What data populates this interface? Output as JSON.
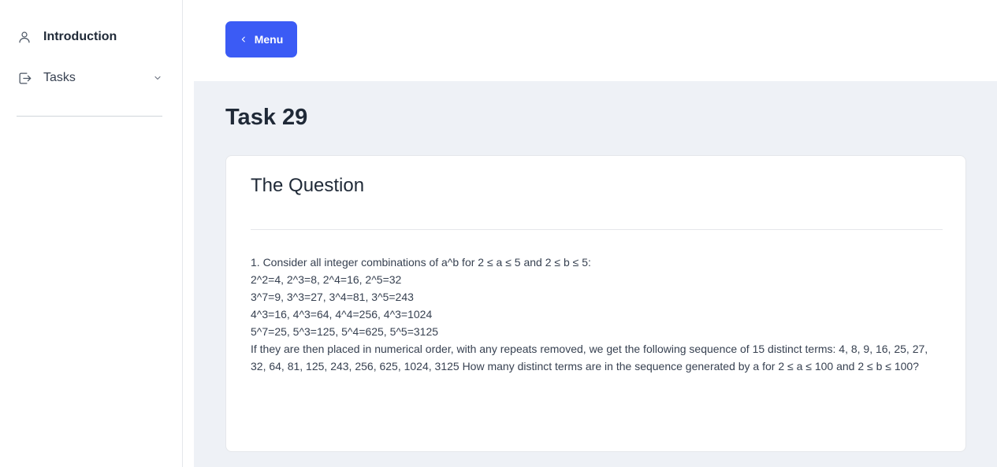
{
  "sidebar": {
    "items": [
      {
        "label": "Introduction",
        "icon": "user-icon"
      },
      {
        "label": "Tasks",
        "icon": "tasks-icon",
        "expandable": true
      }
    ]
  },
  "header": {
    "menu_button_label": "Menu"
  },
  "main": {
    "page_title": "Task 29",
    "card": {
      "title": "The Question",
      "lines": [
        "1. Consider all integer combinations of a^b for 2 ≤ a ≤ 5 and 2 ≤ b ≤ 5:",
        "2^2=4, 2^3=8, 2^4=16, 2^5=32",
        "3^7=9, 3^3=27, 3^4=81, 3^5=243",
        "4^3=16, 4^3=64, 4^4=256, 4^3=1024",
        "5^7=25, 5^3=125, 5^4=625, 5^5=3125",
        "If they are then placed in numerical order, with any repeats removed, we get the following sequence of 15 distinct terms: 4, 8, 9, 16, 25, 27, 32, 64, 81, 125, 243, 256, 625, 1024, 3125 How many distinct terms are in the sequence generated by a for 2 ≤ a ≤ 100 and 2 ≤ b ≤ 100?"
      ]
    }
  },
  "colors": {
    "accent": "#3b5bf5",
    "main_bg": "#eef1f6"
  }
}
